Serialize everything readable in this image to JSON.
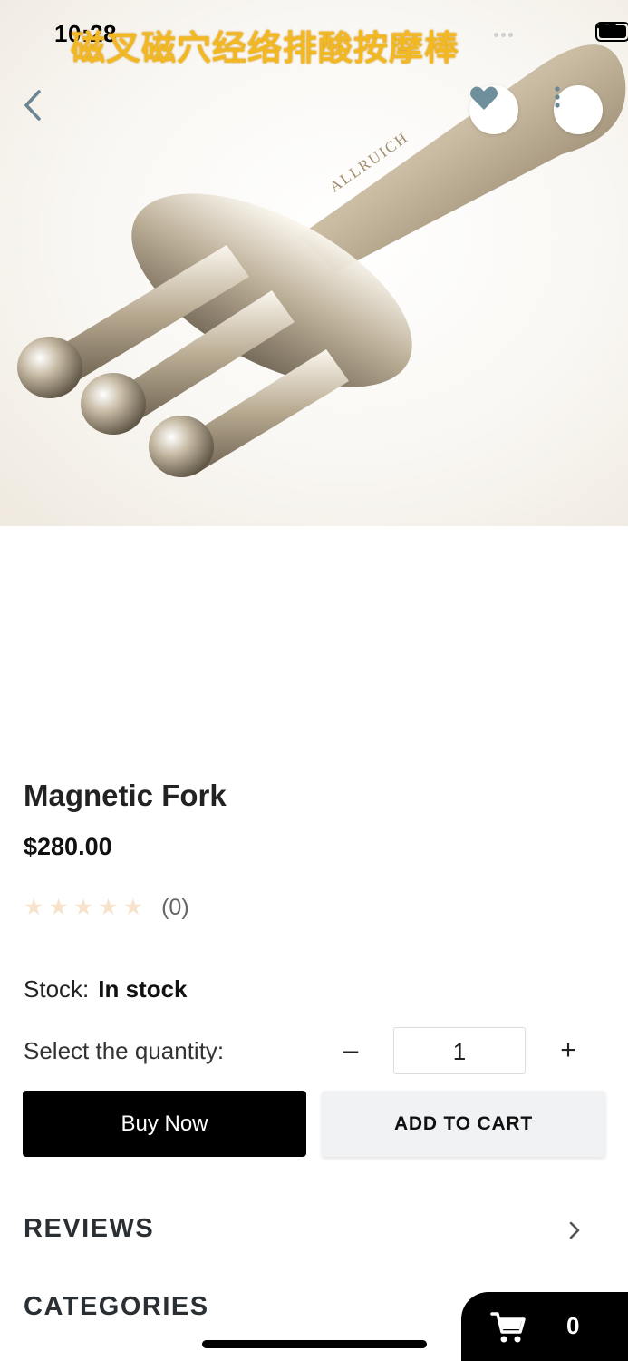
{
  "status_bar": {
    "time": "10:28"
  },
  "banner": {
    "text": "磁叉磁穴经络排酸按摩棒"
  },
  "product_image": {
    "engraving": "ALLRUICH"
  },
  "nav": {
    "back_icon": "chevron-left-icon",
    "favorite_icon": "heart-icon",
    "more_icon": "more-vertical-icon"
  },
  "product": {
    "title": "Magnetic Fork",
    "price": "$280.00",
    "rating_value": 0,
    "rating_count": "(0)",
    "stock_label": "Stock:",
    "stock_value": "In stock"
  },
  "quantity": {
    "label": "Select the quantity:",
    "minus": "–",
    "value": "1",
    "plus": "+"
  },
  "actions": {
    "buy_now": "Buy Now",
    "add_to_cart": "ADD TO CART"
  },
  "sections": {
    "reviews": "REVIEWS",
    "categories": "CATEGORIES"
  },
  "cart": {
    "count": "0",
    "icon": "shopping-cart-icon"
  },
  "colors": {
    "accent_dark": "#000000",
    "heart": "#6f8f9c",
    "star_empty": "#f7e3cc",
    "banner_text": "#f2b824"
  }
}
